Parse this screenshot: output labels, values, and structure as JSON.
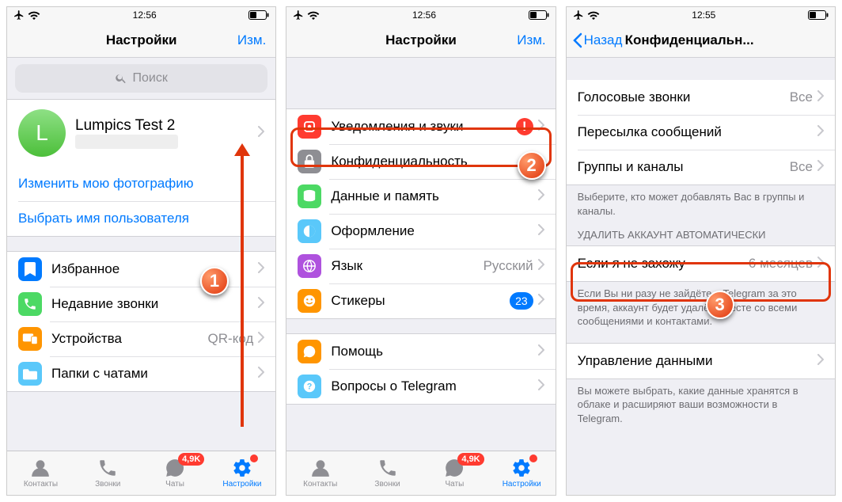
{
  "status": {
    "time1": "12:56",
    "time2": "12:56",
    "time3": "12:55"
  },
  "nav": {
    "settings": "Настройки",
    "edit": "Изм.",
    "back": "Назад",
    "privacy_title": "Конфиденциальн..."
  },
  "search": {
    "placeholder": "Поиск"
  },
  "profile": {
    "name": "Lumpics Test 2",
    "initial": "L"
  },
  "links": {
    "change_photo": "Изменить мою фотографию",
    "choose_username": "Выбрать имя пользователя"
  },
  "s1": {
    "favorites": "Избранное",
    "recent_calls": "Недавние звонки",
    "devices": "Устройства",
    "devices_detail": "QR-код",
    "chat_folders": "Папки с чатами"
  },
  "s2": {
    "notifications": "Уведомления и звуки",
    "privacy": "Конфиденциальность",
    "data": "Данные и память",
    "appearance": "Оформление",
    "language": "Язык",
    "language_value": "Русский",
    "stickers": "Стикеры",
    "stickers_count": "23",
    "help": "Помощь",
    "faq": "Вопросы о Telegram"
  },
  "s3": {
    "voice_calls": "Голосовые звонки",
    "forwarding": "Пересылка сообщений",
    "groups": "Группы и каналы",
    "all": "Все",
    "groups_note": "Выберите, кто может добавлять Вас в группы и каналы.",
    "delete_header": "УДАЛИТЬ АККАУНТ АВТОМАТИЧЕСКИ",
    "if_away": "Если я не захожу",
    "if_away_value": "6 месяцев",
    "away_note": "Если Вы ни разу не зайдёте в Telegram за это время, аккаунт будет удалён вместе со всеми сообщениями и контактами.",
    "data_mgmt": "Управление данными",
    "data_note": "Вы можете выбрать, какие данные хранятся в облаке и расширяют ваши возможности в Telegram."
  },
  "tabs": {
    "contacts": "Контакты",
    "calls": "Звонки",
    "chats": "Чаты",
    "chats_badge": "4,9K",
    "settings": "Настройки"
  },
  "steps": {
    "s1": "1",
    "s2": "2",
    "s3": "3"
  }
}
